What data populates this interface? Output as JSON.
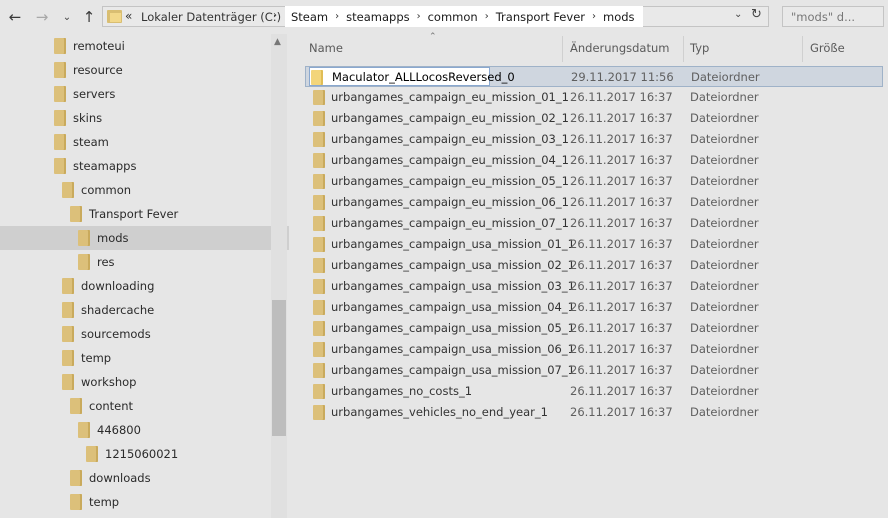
{
  "window": {
    "search_placeholder": "\"mods\" d..."
  },
  "address": {
    "root": "Lokaler Datenträger (C:)",
    "overflow": "«",
    "separator": "›",
    "segments": [
      "Steam",
      "steamapps",
      "common",
      "Transport Fever",
      "mods"
    ]
  },
  "nav": {
    "back": "←",
    "forward": "→",
    "recent": "⌄",
    "up": "↑",
    "dropdown": "⌄",
    "refresh": "↻"
  },
  "tree": {
    "items": [
      {
        "label": "remoteui",
        "selected": false
      },
      {
        "label": "resource",
        "selected": false
      },
      {
        "label": "servers",
        "selected": false
      },
      {
        "label": "skins",
        "selected": false
      },
      {
        "label": "steam",
        "selected": false
      },
      {
        "label": "steamapps",
        "selected": false
      },
      {
        "label": "common",
        "selected": false
      },
      {
        "label": "Transport Fever",
        "selected": false
      },
      {
        "label": "mods",
        "selected": true
      },
      {
        "label": "res",
        "selected": false
      },
      {
        "label": "downloading",
        "selected": false
      },
      {
        "label": "shadercache",
        "selected": false
      },
      {
        "label": "sourcemods",
        "selected": false
      },
      {
        "label": "temp",
        "selected": false
      },
      {
        "label": "workshop",
        "selected": false
      },
      {
        "label": "content",
        "selected": false
      },
      {
        "label": "446800",
        "selected": false
      },
      {
        "label": "1215060021",
        "selected": false
      },
      {
        "label": "downloads",
        "selected": false
      },
      {
        "label": "temp",
        "selected": false
      }
    ]
  },
  "columns": {
    "name": "Name",
    "date": "Änderungsdatum",
    "type": "Typ",
    "size": "Größe"
  },
  "files": [
    {
      "name": "Maculator_ALLLocosReversed_0",
      "date": "29.11.2017 11:56",
      "type": "Dateiordner",
      "selected": true
    },
    {
      "name": "urbangames_campaign_eu_mission_01_1",
      "date": "26.11.2017 16:37",
      "type": "Dateiordner"
    },
    {
      "name": "urbangames_campaign_eu_mission_02_1",
      "date": "26.11.2017 16:37",
      "type": "Dateiordner"
    },
    {
      "name": "urbangames_campaign_eu_mission_03_1",
      "date": "26.11.2017 16:37",
      "type": "Dateiordner"
    },
    {
      "name": "urbangames_campaign_eu_mission_04_1",
      "date": "26.11.2017 16:37",
      "type": "Dateiordner"
    },
    {
      "name": "urbangames_campaign_eu_mission_05_1",
      "date": "26.11.2017 16:37",
      "type": "Dateiordner"
    },
    {
      "name": "urbangames_campaign_eu_mission_06_1",
      "date": "26.11.2017 16:37",
      "type": "Dateiordner"
    },
    {
      "name": "urbangames_campaign_eu_mission_07_1",
      "date": "26.11.2017 16:37",
      "type": "Dateiordner"
    },
    {
      "name": "urbangames_campaign_usa_mission_01_1",
      "date": "26.11.2017 16:37",
      "type": "Dateiordner"
    },
    {
      "name": "urbangames_campaign_usa_mission_02_1",
      "date": "26.11.2017 16:37",
      "type": "Dateiordner"
    },
    {
      "name": "urbangames_campaign_usa_mission_03_1",
      "date": "26.11.2017 16:37",
      "type": "Dateiordner"
    },
    {
      "name": "urbangames_campaign_usa_mission_04_1",
      "date": "26.11.2017 16:37",
      "type": "Dateiordner"
    },
    {
      "name": "urbangames_campaign_usa_mission_05_1",
      "date": "26.11.2017 16:37",
      "type": "Dateiordner"
    },
    {
      "name": "urbangames_campaign_usa_mission_06_1",
      "date": "26.11.2017 16:37",
      "type": "Dateiordner"
    },
    {
      "name": "urbangames_campaign_usa_mission_07_1",
      "date": "26.11.2017 16:37",
      "type": "Dateiordner"
    },
    {
      "name": "urbangames_no_costs_1",
      "date": "26.11.2017 16:37",
      "type": "Dateiordner"
    },
    {
      "name": "urbangames_vehicles_no_end_year_1",
      "date": "26.11.2017 16:37",
      "type": "Dateiordner"
    }
  ],
  "colors": {
    "folder": "#dcc07a",
    "selection": "#cfd6df"
  }
}
